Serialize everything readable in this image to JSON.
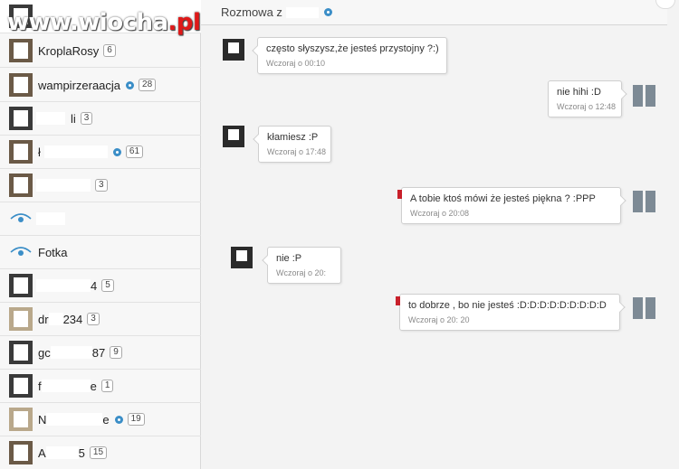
{
  "watermark": {
    "text": "www.wiocha.pl",
    "prefix": "www.",
    "name": "wiocha",
    "suffix": ".pl"
  },
  "sidebar": {
    "contacts": [
      {
        "label": "",
        "badge": ""
      },
      {
        "label": "KroplaRosy",
        "badge": "6"
      },
      {
        "label": "wampirzeraacja",
        "badge": "28"
      },
      {
        "label": "li",
        "badge": "3"
      },
      {
        "label": "ł",
        "badge": "61"
      },
      {
        "label": "",
        "badge": "3"
      },
      {
        "label": "",
        "badge": ""
      },
      {
        "label": "Fotka",
        "badge": ""
      },
      {
        "label": "4",
        "badge": "5"
      },
      {
        "label": "dr",
        "suffix": "234",
        "badge": "3"
      },
      {
        "label": "gc",
        "suffix": "87",
        "badge": "9"
      },
      {
        "label": "f",
        "suffix": "e",
        "badge": "1"
      },
      {
        "label": "N",
        "suffix": "e",
        "badge": "19"
      },
      {
        "label": "A",
        "suffix": "5",
        "badge": "15"
      }
    ]
  },
  "chat": {
    "title": "Rozmowa z",
    "messages": [
      {
        "text": "często słyszysz,że jesteś przystojny ?:)",
        "time": "Wczoraj o 00:10",
        "side": "left"
      },
      {
        "text": "nie hihi :D",
        "time": "Wczoraj o 12:48",
        "side": "right"
      },
      {
        "text": "kłamiesz :P",
        "time": "Wczoraj o 17:48",
        "side": "left"
      },
      {
        "text": "A tobie ktoś mówi że jesteś piękna ?  :PPP",
        "time": "Wczoraj o 20:08",
        "side": "right"
      },
      {
        "text": "nie :P",
        "time": "Wczoraj o 20:",
        "side": "left"
      },
      {
        "text": "to dobrze , bo nie jesteś :D:D:D:D:D:D:D:D:D",
        "time": "Wczoraj o 20: 20",
        "side": "right"
      }
    ]
  },
  "colors": {
    "accent": "#3b8ec7",
    "unread": "#c8202a"
  }
}
